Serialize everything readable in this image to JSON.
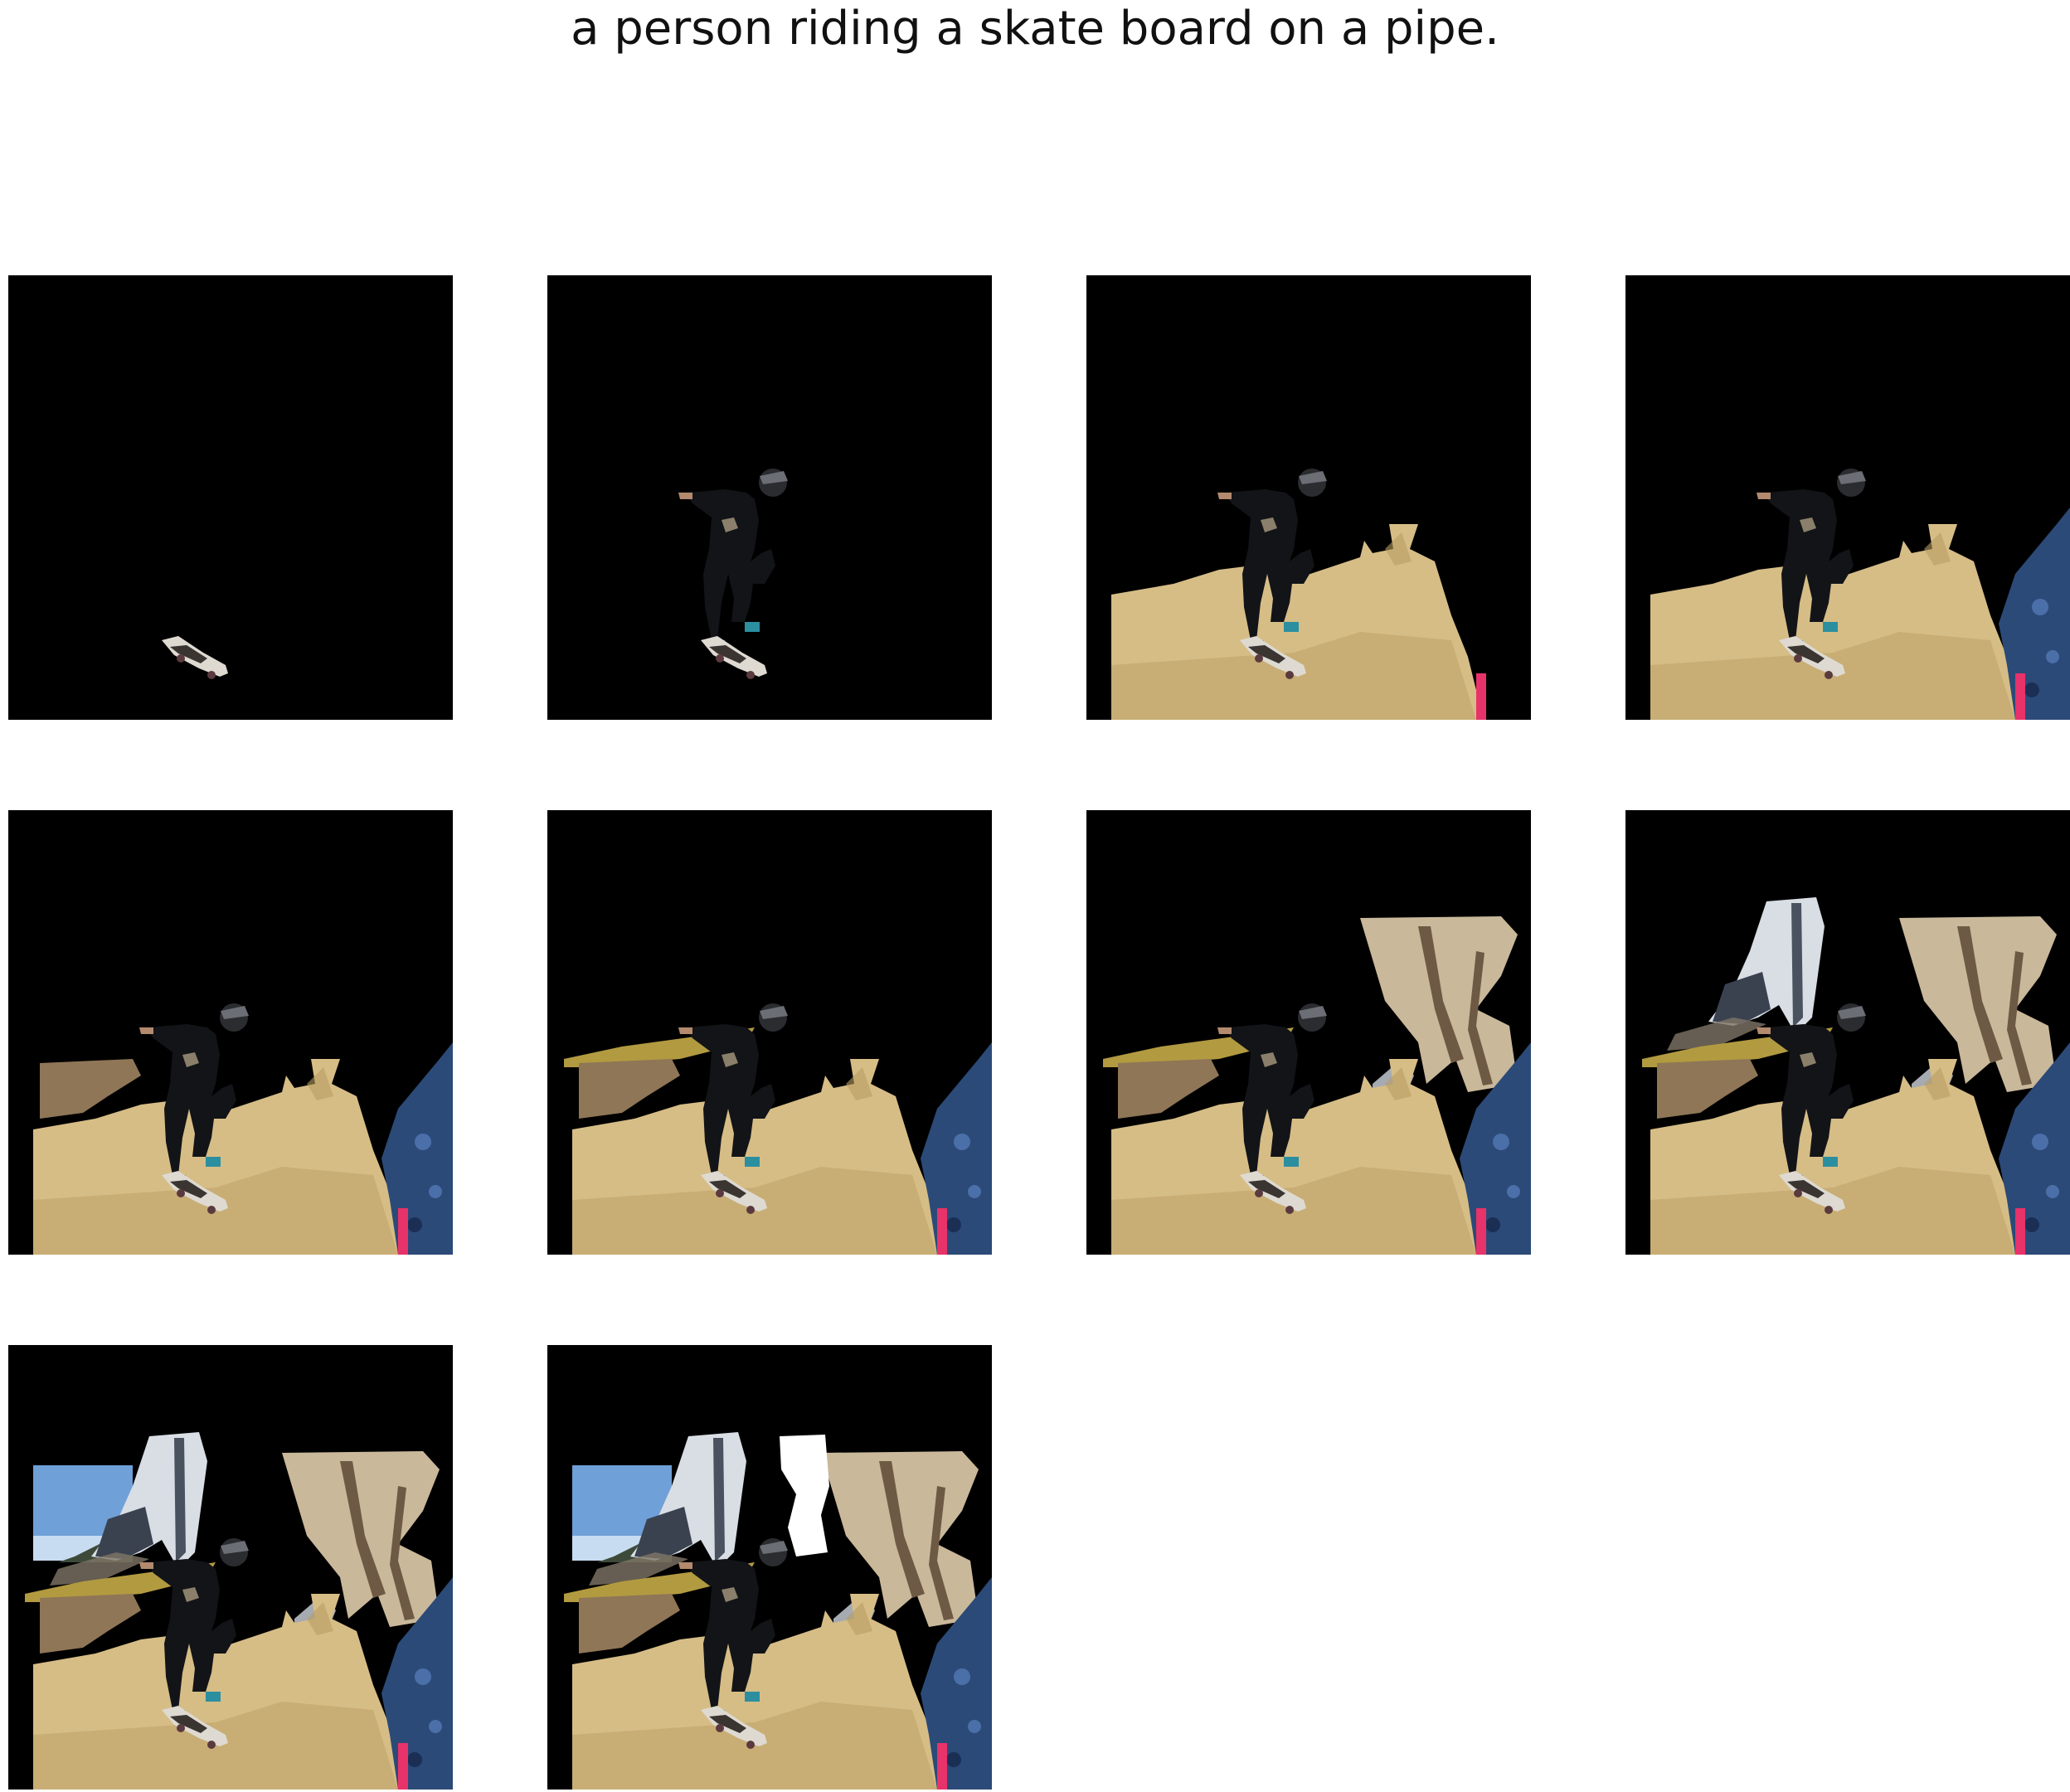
{
  "caption": "a person riding a skate board on a pipe.",
  "colors": {
    "background": "#000000",
    "ground": "#d6bd86",
    "groundShadow": "#b89c62",
    "wall": "#8f7657",
    "ledge": "#b29a40",
    "foliage": "#2c4a78",
    "tree": "#c9b89a",
    "treeDark": "#6e5a44",
    "sky": "#6fa0d8",
    "skyLight": "#c7dcf0",
    "pole": "#d9dee5",
    "pink": "#e8326a",
    "person": "#121418",
    "skateboard": "#dedad2",
    "shoe": "#2c8fa0",
    "white": "#ffffff"
  },
  "panels": [
    {
      "step": 1,
      "layers": [
        "skateboard"
      ]
    },
    {
      "step": 2,
      "layers": [
        "skateboard",
        "person"
      ]
    },
    {
      "step": 3,
      "layers": [
        "skateboard",
        "person",
        "ground",
        "pink"
      ]
    },
    {
      "step": 4,
      "layers": [
        "skateboard",
        "person",
        "ground",
        "pink",
        "foliage"
      ]
    },
    {
      "step": 5,
      "layers": [
        "skateboard",
        "person",
        "ground",
        "pink",
        "foliage",
        "wall"
      ]
    },
    {
      "step": 6,
      "layers": [
        "skateboard",
        "person",
        "ground",
        "pink",
        "foliage",
        "wall",
        "ledge"
      ]
    },
    {
      "step": 7,
      "layers": [
        "skateboard",
        "person",
        "ground",
        "pink",
        "foliage",
        "wall",
        "ledge",
        "tree"
      ]
    },
    {
      "step": 8,
      "layers": [
        "skateboard",
        "person",
        "ground",
        "pink",
        "foliage",
        "wall",
        "ledge",
        "tree",
        "pole"
      ]
    },
    {
      "step": 9,
      "layers": [
        "skateboard",
        "person",
        "ground",
        "pink",
        "foliage",
        "wall",
        "ledge",
        "tree",
        "pole",
        "sky"
      ]
    },
    {
      "step": 10,
      "layers": [
        "skateboard",
        "person",
        "ground",
        "pink",
        "foliage",
        "wall",
        "ledge",
        "tree",
        "pole",
        "sky",
        "white"
      ]
    }
  ]
}
